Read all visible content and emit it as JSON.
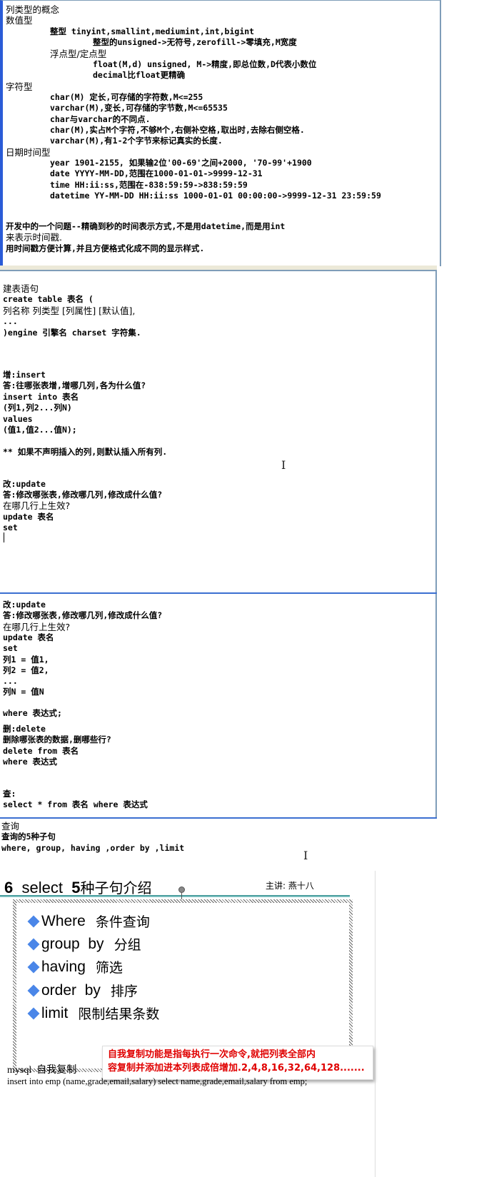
{
  "panel1": {
    "lines": [
      "列类型的概念",
      "数值型",
      "整型 tinyint,smallint,mediumint,int,bigint",
      "整型的unsigned->无符号,zerofill->零填充,M宽度",
      "浮点型/定点型",
      "float(M,d) unsigned, M->精度,即总位数,D代表小数位",
      "decimal比float更精确",
      "字符型",
      "char(M) 定长,可存储的字符数,M<=255",
      "varchar(M),变长,可存储的字节数,M<=65535",
      "char与varchar的不同点.",
      "char(M),实占M个字符,不够M个,右侧补空格,取出时,去除右侧空格.",
      "varchar(M),有1-2个字节来标记真实的长度.",
      "日期时间型",
      "year 1901-2155, 如果输2位'00-69'之间+2000, '70-99'+1900",
      "date YYYY-MM-DD,范围在1000-01-01->9999-12-31",
      "time HH:ii:ss,范围在-838:59:59->838:59:59",
      "datetime YY-MM-DD HH:ii:ss 1000-01-01 00:00:00->9999-12-31 23:59:59",
      "开发中的一个问题--精确到秒的时间表示方式,不是用datetime,而是用int",
      "来表示时间戳.",
      "用时间戳方便计算,并且方便格式化成不同的显示样式."
    ]
  },
  "panel2": {
    "lines": [
      "建表语句",
      "create table 表名 (",
      "列名称 列类型 [列属性] [默认值],",
      "...",
      ")engine 引擎名 charset 字符集.",
      "增:insert",
      "答:往哪张表增,增哪几列,各为什么值?",
      "insert into 表名",
      "(列1,列2...列N)",
      "values",
      "(值1,值2...值N);",
      "** 如果不声明插入的列,则默认插入所有列.",
      "改:update",
      "答:修改哪张表,修改哪几列,修改成什么值?",
      "在哪几行上生效?",
      "update 表名",
      "set"
    ]
  },
  "panel3": {
    "lines": [
      "改:update",
      "答:修改哪张表,修改哪几列,修改成什么值?",
      "在哪几行上生效?",
      "update 表名",
      "set",
      "列1 = 值1,",
      "列2 = 值2,",
      "...",
      "列N = 值N",
      "where 表达式;",
      "删:delete",
      "删除哪张表的数据,删哪些行?",
      "delete from 表名",
      "where 表达式",
      "查:",
      "select * from 表名 where 表达式"
    ]
  },
  "panel4": {
    "lines": [
      "查询",
      "查询的5种子句",
      "where, group, having ,order by ,limit"
    ]
  },
  "slide": {
    "number": "6",
    "title_select": "select",
    "title_5": "5",
    "title_rest": "种子句介绍",
    "presenter": "主讲: 燕十八",
    "bullets": [
      {
        "en": "Where",
        "cn": "条件查询"
      },
      {
        "en": "group  by",
        "cn": "分组"
      },
      {
        "en": "having",
        "cn": "筛选"
      },
      {
        "en": "order  by",
        "cn": "排序"
      },
      {
        "en": "limit",
        "cn": "限制结果条数"
      }
    ],
    "callout_line1": "自我复制功能是指每执行一次命令,就把列表全部内",
    "callout_line2": "容复制并添加进本列表成倍增加.2,4,8,16,32,64,128.......",
    "mysql_label": "mysql  自我复制",
    "insert_sql": "insert into emp (name,grade,email,salary) select name,grade,email,salary from emp;",
    "bullet_color": "#4a86e8",
    "callout_color": "#e00000"
  }
}
